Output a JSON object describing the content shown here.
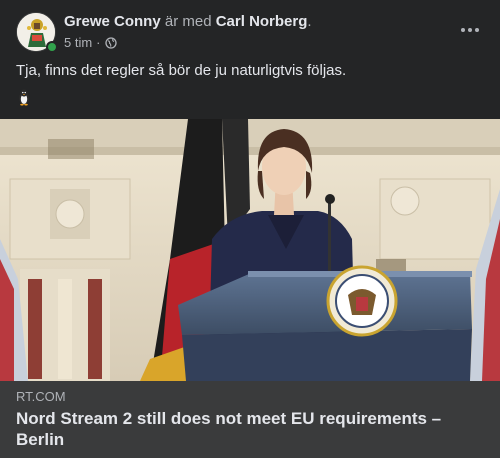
{
  "post": {
    "author": "Grewe Conny",
    "with_text": "är med",
    "tagged": "Carl Norberg",
    "period": ".",
    "time": "5 tim",
    "separator": "·",
    "audience_icon": "globe-icon",
    "more_icon": "more-options-icon",
    "text": "Tja, finns det regler så bör de ju naturligtvis följas.",
    "emoji": "penguin-emoji"
  },
  "link_preview": {
    "domain": "RT.COM",
    "headline": "Nord Stream 2 still does not meet EU requirements – Berlin"
  },
  "colors": {
    "background": "#242526",
    "preview_background": "#3a3b3c",
    "primary_text": "#e4e6eb",
    "secondary_text": "#b0b3b8",
    "online_status": "#31a24c"
  }
}
